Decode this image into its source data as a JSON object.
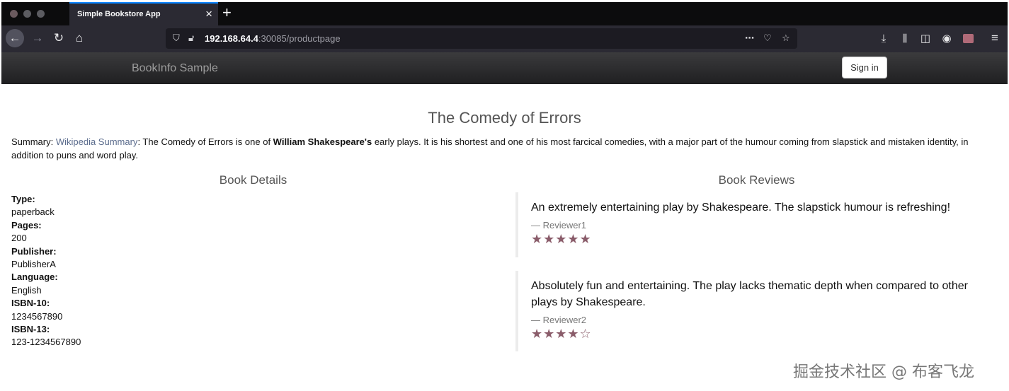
{
  "browser": {
    "tab_title": "Simple Bookstore App",
    "url_host": "192.168.64.4",
    "url_rest": ":30085/productpage"
  },
  "app": {
    "brand": "BookInfo Sample",
    "signin_label": "Sign in"
  },
  "product": {
    "title": "The Comedy of Errors",
    "summary_prefix": "Summary: ",
    "summary_link": "Wikipedia Summary",
    "summary_text_a": ": The Comedy of Errors is one of ",
    "summary_bold": "William Shakespeare's",
    "summary_text_b": " early plays. It is his shortest and one of his most farcical comedies, with a major part of the humour coming from slapstick and mistaken identity, in addition to puns and word play."
  },
  "details": {
    "heading": "Book Details",
    "items": [
      {
        "label": "Type:",
        "value": "paperback"
      },
      {
        "label": "Pages:",
        "value": "200"
      },
      {
        "label": "Publisher:",
        "value": "PublisherA"
      },
      {
        "label": "Language:",
        "value": "English"
      },
      {
        "label": "ISBN-10:",
        "value": "1234567890"
      },
      {
        "label": "ISBN-13:",
        "value": "123-1234567890"
      }
    ]
  },
  "reviews": {
    "heading": "Book Reviews",
    "items": [
      {
        "text": "An extremely entertaining play by Shakespeare. The slapstick humour is refreshing!",
        "reviewer": "— Reviewer1",
        "stars": "★★★★★",
        "rating": 5
      },
      {
        "text": "Absolutely fun and entertaining. The play lacks thematic depth when compared to other plays by Shakespeare.",
        "reviewer": "— Reviewer2",
        "stars": "★★★★☆",
        "rating": 4
      }
    ]
  },
  "watermark": "掘金技术社区 @ 布客飞龙",
  "colors": {
    "star": "#8a5c6a",
    "link": "#5a6b8c",
    "tab_accent": "#0a84ff"
  }
}
